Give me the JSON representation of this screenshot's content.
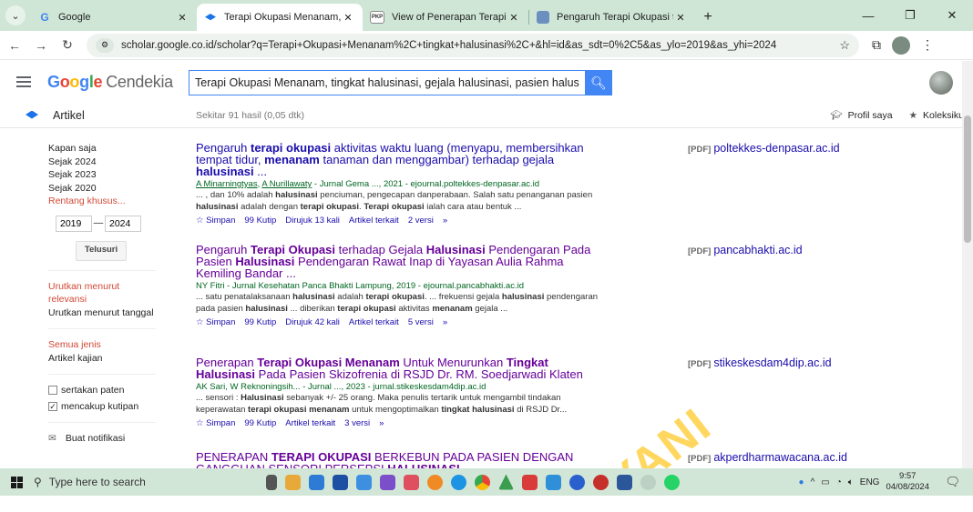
{
  "browser": {
    "tabs": [
      {
        "label": "Google",
        "icon": "G",
        "active": false
      },
      {
        "label": "Terapi Okupasi Menanam, tingk",
        "icon": "cap",
        "active": true
      },
      {
        "label": "View of Penerapan Terapi Okup",
        "icon": "PKP",
        "active": false
      },
      {
        "label": "Pengaruh Terapi Okupasi terha",
        "icon": "doc",
        "active": false
      }
    ],
    "url": "scholar.google.co.id/scholar?q=Terapi+Okupasi+Menanam%2C+tingkat+halusinasi%2C+&hl=id&as_sdt=0%2C5&as_ylo=2019&as_yhi=2024"
  },
  "header": {
    "logo_google": "Google",
    "logo_rest": "Cendekia",
    "search_value": "Terapi Okupasi Menanam, tingkat halusinasi, gejala halusinasi, pasien halusinasi"
  },
  "subbar": {
    "section": "Artikel",
    "count": "Sekitar 91 hasil (0,05 dtk)",
    "profile": "Profil saya",
    "library": "Koleksiku"
  },
  "sidebar": {
    "time_items": [
      "Kapan saja",
      "Sejak 2024",
      "Sejak 2023",
      "Sejak 2020"
    ],
    "custom_range": "Rentang khusus...",
    "year_from": "2019",
    "year_to": "2024",
    "search_btn": "Telusuri",
    "sort_relevance": "Urutkan menurut relevansi",
    "sort_date": "Urutkan menurut tanggal",
    "type_all": "Semua jenis",
    "type_review": "Artikel kajian",
    "include_patents": "sertakan paten",
    "include_citations": "mencakup kutipan",
    "create_alert": "Buat notifikasi"
  },
  "results": [
    {
      "title_html": "Pengaruh <b>terapi okupasi</b> aktivitas waktu luang (menyapu, membersihkan tempat tidur, <b>menanam</b> tanaman dan menggambar) terhadap gejala <b>halusinasi</b> ...",
      "meta_html": "<u>A Minarningtyas</u>, <u>A Nurillawaty</u> - Jurnal Gema ..., 2021 - ejournal.poltekkes-denpasar.ac.id",
      "snippet_html": "... , dan 10% adalah <b>halusinasi</b> penciuman, pengecapan danperabaan. Salah satu penanganan pasien <b>halusinasi</b> adalah dengan <b>terapi okupasi</b>. <b>Terapi okupasi</b> ialah cara atau bentuk ...",
      "links": [
        "☆ Simpan",
        "99 Kutip",
        "Dirujuk 13 kali",
        "Artikel terkait",
        "2 versi",
        "»"
      ],
      "pdf_source": "poltekkes-denpasar.ac.id",
      "visited": false
    },
    {
      "title_html": "Pengaruh <b>Terapi Okupasi</b> terhadap Gejala <b>Halusinasi</b> Pendengaran Pada Pasien <b>Halusinasi</b> Pendengaran Rawat Inap di Yayasan Aulia Rahma Kemiling Bandar ...",
      "meta_html": "NY Fitri - Jurnal Kesehatan Panca Bhakti Lampung, 2019 - ejournal.pancabhakti.ac.id",
      "snippet_html": "... satu penatalaksanaan <b>halusinasi</b> adalah <b>terapi okupasi</b>. ... frekuensi gejala <b>halusinasi</b> pendengaran pada pasien <b>halusinasi</b> ... diberikan <b>terapi okupasi</b> aktivitas <b>menanam</b> gejala ...",
      "links": [
        "☆ Simpan",
        "99 Kutip",
        "Dirujuk 42 kali",
        "Artikel terkait",
        "5 versi",
        "»"
      ],
      "pdf_source": "pancabhakti.ac.id",
      "visited": true
    },
    {
      "title_html": "Penerapan <b>Terapi Okupasi Menanam</b> Untuk Menurunkan <b>Tingkat Halusinasi</b> Pada Pasien Skizofrenia di RSJD Dr. RM. Soedjarwadi Klaten",
      "meta_html": "AK Sari, W Reknoningsih... - Jurnal ..., 2023 - jurnal.stikeskesdam4dip.ac.id",
      "snippet_html": "... sensori : <b>Halusinasi</b> sebanyak +/- 25 orang. Maka penulis tertarik untuk mengambil tindakan keperawatan <b>terapi okupasi menanam</b> untuk mengoptimalkan <b>tingkat halusinasi</b> di RSJD Dr...",
      "links": [
        "☆ Simpan",
        "99 Kutip",
        "Artikel terkait",
        "3 versi",
        "»"
      ],
      "pdf_source": "stikeskesdam4dip.ac.id",
      "visited": true
    },
    {
      "title_html": "PENERAPAN <b>TERAPI OKUPASI</b> BERKEBUN PADA PASIEN DENGAN GANGGUAN SENSORI PERSEPSI <b>HALUSINASI</b>",
      "meta_html": "",
      "snippet_html": "",
      "links": [],
      "pdf_source": "akperdharmawacana.ac.id",
      "visited": true
    }
  ],
  "pdf_tag": "[PDF]",
  "watermark": "YANI",
  "taskbar": {
    "search_placeholder": "Type here to search",
    "lang": "ENG",
    "time": "9:57",
    "date": "04/08/2024"
  }
}
